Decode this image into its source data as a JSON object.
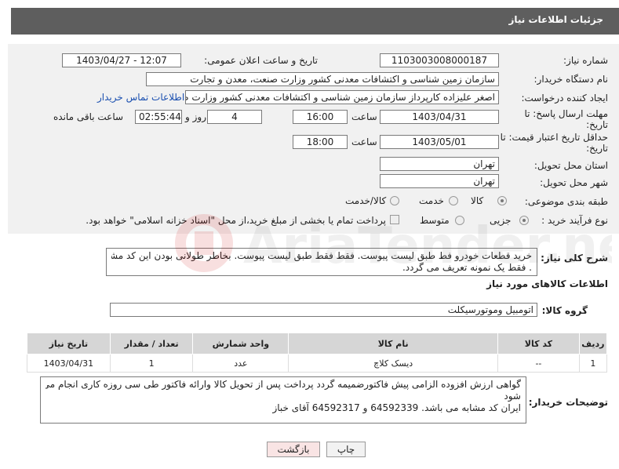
{
  "header": {
    "title": "جزئیات اطلاعات نیاز"
  },
  "form": {
    "need_number": {
      "label": "شماره نیاز:",
      "value": "1103003008000187"
    },
    "announce_datetime": {
      "label": "تاریخ و ساعت اعلان عمومی:",
      "value": "1403/04/27 - 12:07"
    },
    "buyer_org": {
      "label": "نام دستگاه خریدار:",
      "value": "سازمان زمین شناسی و اکتشافات معدنی کشور وزارت صنعت، معدن و تجارت"
    },
    "requester": {
      "label": "ایجاد کننده درخواست:",
      "value": "اصغر علیزاده کارپرداز سازمان زمین شناسی و اکتشافات معدنی کشور وزارت صنعت",
      "contact_link": "اطلاعات تماس خریدار"
    },
    "reply_deadline": {
      "label_line1": "مهلت ارسال پاسخ: تا",
      "label_line2": "تاریخ:",
      "date": "1403/04/31",
      "time_label": "ساعت",
      "time": "16:00",
      "days": "4",
      "days_label": "روز و",
      "remaining": "02:55:44",
      "remaining_label": "ساعت باقی مانده"
    },
    "price_validity": {
      "label_line1": "حداقل تاریخ اعتبار قیمت: تا",
      "label_line2": "تاریخ:",
      "date": "1403/05/01",
      "time_label": "ساعت",
      "time": "18:00"
    },
    "province": {
      "label": "استان محل تحویل:",
      "value": "تهران"
    },
    "city": {
      "label": "شهر محل تحویل:",
      "value": "تهران"
    },
    "category": {
      "label": "طبقه بندی موضوعی:",
      "options": [
        "کالا",
        "خدمت",
        "کالا/خدمت"
      ],
      "selected": 0
    },
    "purchase_type": {
      "label": "نوع فرآیند خرید :",
      "options": [
        "جزیی",
        "متوسط"
      ],
      "selected": 0,
      "treasury_note": "پرداخت تمام یا بخشی از مبلغ خرید،از محل \"اسناد خزانه اسلامی\" خواهد بود."
    },
    "summary": {
      "label": "شرح کلی نیاز:",
      "line1": "خرید قطعات خودرو فط طبق لیست پیوست. فقط فقط طبق لیست پیوست.  بخاطر طولانی بودن این کد مشابه",
      "line2": ". فقط یک نمونه تعریف می گردد."
    }
  },
  "goods": {
    "section_title": "اطلاعات کالاهای مورد نیاز",
    "group_label": "گروه کالا:",
    "group_value": "اتومبیل وموتورسیکلت",
    "table": {
      "headers": [
        "ردیف",
        "کد کالا",
        "نام کالا",
        "واحد شمارش",
        "تعداد / مقدار",
        "تاریخ نیاز"
      ],
      "rows": [
        [
          "1",
          "--",
          "دیسک کلاچ",
          "عدد",
          "1",
          "1403/04/31"
        ]
      ]
    }
  },
  "buyer_notes": {
    "label": "توضیحات خریدار:",
    "line1": "گواهی ارزش افزوده الزامی پیش فاکتورضمیمه گردد پرداخت پس از تحویل کالا وارائه فاکتور طی سی روزه کاری انجام می",
    "line2": "شود",
    "line3": "ایران کد مشابه می باشد.  64592339  و 64592317   آقای خباز"
  },
  "buttons": {
    "print": "چاپ",
    "back": "بازگشت"
  },
  "watermark": {
    "text": "AriaTender.net"
  }
}
